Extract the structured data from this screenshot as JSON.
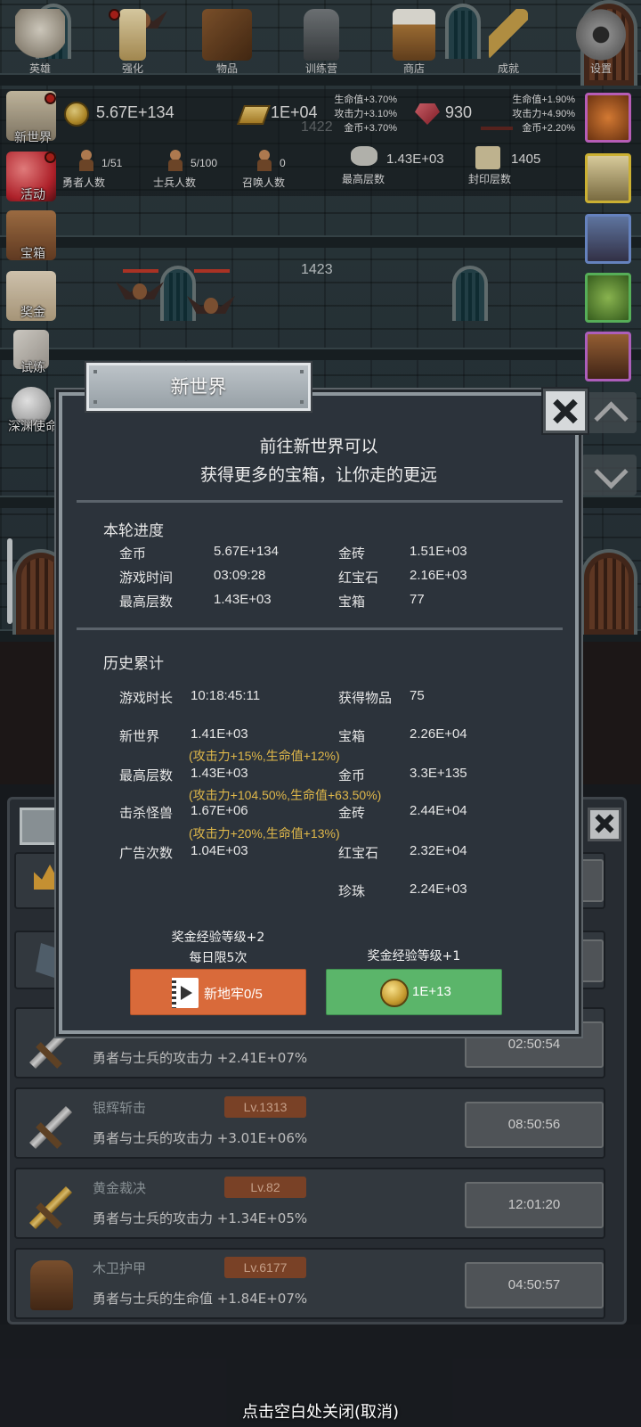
{
  "floors": {
    "upper": "1422",
    "lower": "1423"
  },
  "resources": {
    "gold": "5.67E+134",
    "gold_bars": "1E+04",
    "rubies": "930",
    "gold_bonus": {
      "hp": "生命值+3.70%",
      "atk": "攻击力+3.10%",
      "gold": "金币+3.70%"
    },
    "ruby_bonus": {
      "hp": "生命值+1.90%",
      "atk": "攻击力+4.90%",
      "gold": "金币+2.20%"
    }
  },
  "counts": {
    "heroes": {
      "value": "1/51",
      "label": "勇者人数"
    },
    "soldiers": {
      "value": "5/100",
      "label": "士兵人数"
    },
    "summons": {
      "value": "0",
      "label": "召唤人数"
    },
    "max_floor": {
      "value": "1.43E+03",
      "label": "最高层数"
    },
    "sealed_floor": {
      "value": "1405",
      "label": "封印层数"
    }
  },
  "side_menu": [
    {
      "label": "新世界",
      "icon": "castle-icon"
    },
    {
      "label": "活动",
      "icon": "heart-icon"
    },
    {
      "label": "宝箱",
      "icon": "chest-icon"
    },
    {
      "label": "奖金",
      "icon": "envelope-icon"
    },
    {
      "label": "试炼",
      "icon": "feather-icon"
    },
    {
      "label": "深渊使命",
      "icon": "orb-icon"
    }
  ],
  "dialog": {
    "title": "新世界",
    "intro_line1": "前往新世界可以",
    "intro_line2": "获得更多的宝箱，让你走的更远",
    "round_title": "本轮进度",
    "round": {
      "gold_label": "金币",
      "gold": "5.67E+134",
      "goldbar_label": "金砖",
      "goldbar": "1.51E+03",
      "time_label": "游戏时间",
      "time": "03:09:28",
      "ruby_label": "红宝石",
      "ruby": "2.16E+03",
      "maxfloor_label": "最高层数",
      "maxfloor": "1.43E+03",
      "chest_label": "宝箱",
      "chest": "77"
    },
    "history_title": "历史累计",
    "history": {
      "playtime_label": "游戏时长",
      "playtime": "10:18:45:11",
      "items_label": "获得物品",
      "items": "75",
      "newworld_label": "新世界",
      "newworld": "1.41E+03",
      "newworld_bonus": "(攻击力+15%,生命值+12%)",
      "chest_label": "宝箱",
      "chest": "2.26E+04",
      "maxfloor_label": "最高层数",
      "maxfloor": "1.43E+03",
      "maxfloor_bonus": "(攻击力+104.50%,生命值+63.50%)",
      "gold_label": "金币",
      "gold": "3.3E+135",
      "kills_label": "击杀怪兽",
      "kills": "1.67E+06",
      "kills_bonus": "(攻击力+20%,生命值+13%)",
      "goldbar_label": "金砖",
      "goldbar": "2.44E+04",
      "ads_label": "广告次数",
      "ads": "1.04E+03",
      "ruby_label": "红宝石",
      "ruby": "2.32E+04",
      "pearl_label": "珍珠",
      "pearl": "2.24E+03"
    },
    "left_caption1": "奖金经验等级+2",
    "left_caption2": "每日限5次",
    "right_caption": "奖金经验等级+1",
    "left_button": "新地牢0/5",
    "right_button": "1E+13"
  },
  "skills": [
    {
      "name": "",
      "level": "",
      "desc": "勇者与士兵的攻击力 +2.41E+07%",
      "timer": "02:50:54"
    },
    {
      "name": "银辉斩击",
      "level": "Lv.1313",
      "desc": "勇者与士兵的攻击力 +3.01E+06%",
      "timer": "08:50:56"
    },
    {
      "name": "黄金裁决",
      "level": "Lv.82",
      "desc": "勇者与士兵的攻击力 +1.34E+05%",
      "timer": "12:01:20"
    },
    {
      "name": "木卫护甲",
      "level": "Lv.6177",
      "desc": "勇者与士兵的生命值 +1.84E+07%",
      "timer": "04:50:57"
    }
  ],
  "bottom_nav": [
    {
      "label": "英雄",
      "icon": "skull-icon"
    },
    {
      "label": "强化",
      "icon": "candle-icon"
    },
    {
      "label": "物品",
      "icon": "book-icon"
    },
    {
      "label": "训练营",
      "icon": "lantern-icon"
    },
    {
      "label": "商店",
      "icon": "mug-icon"
    },
    {
      "label": "成就",
      "icon": "key-icon"
    },
    {
      "label": "设置",
      "icon": "gear-icon"
    }
  ],
  "close_hint": "点击空白处关闭(取消)",
  "colors": {
    "orange_button": "#d96a3a",
    "green_button": "#5bb56a",
    "bonus_text": "#e0b84a",
    "dialog_bg": "#2c333b"
  }
}
